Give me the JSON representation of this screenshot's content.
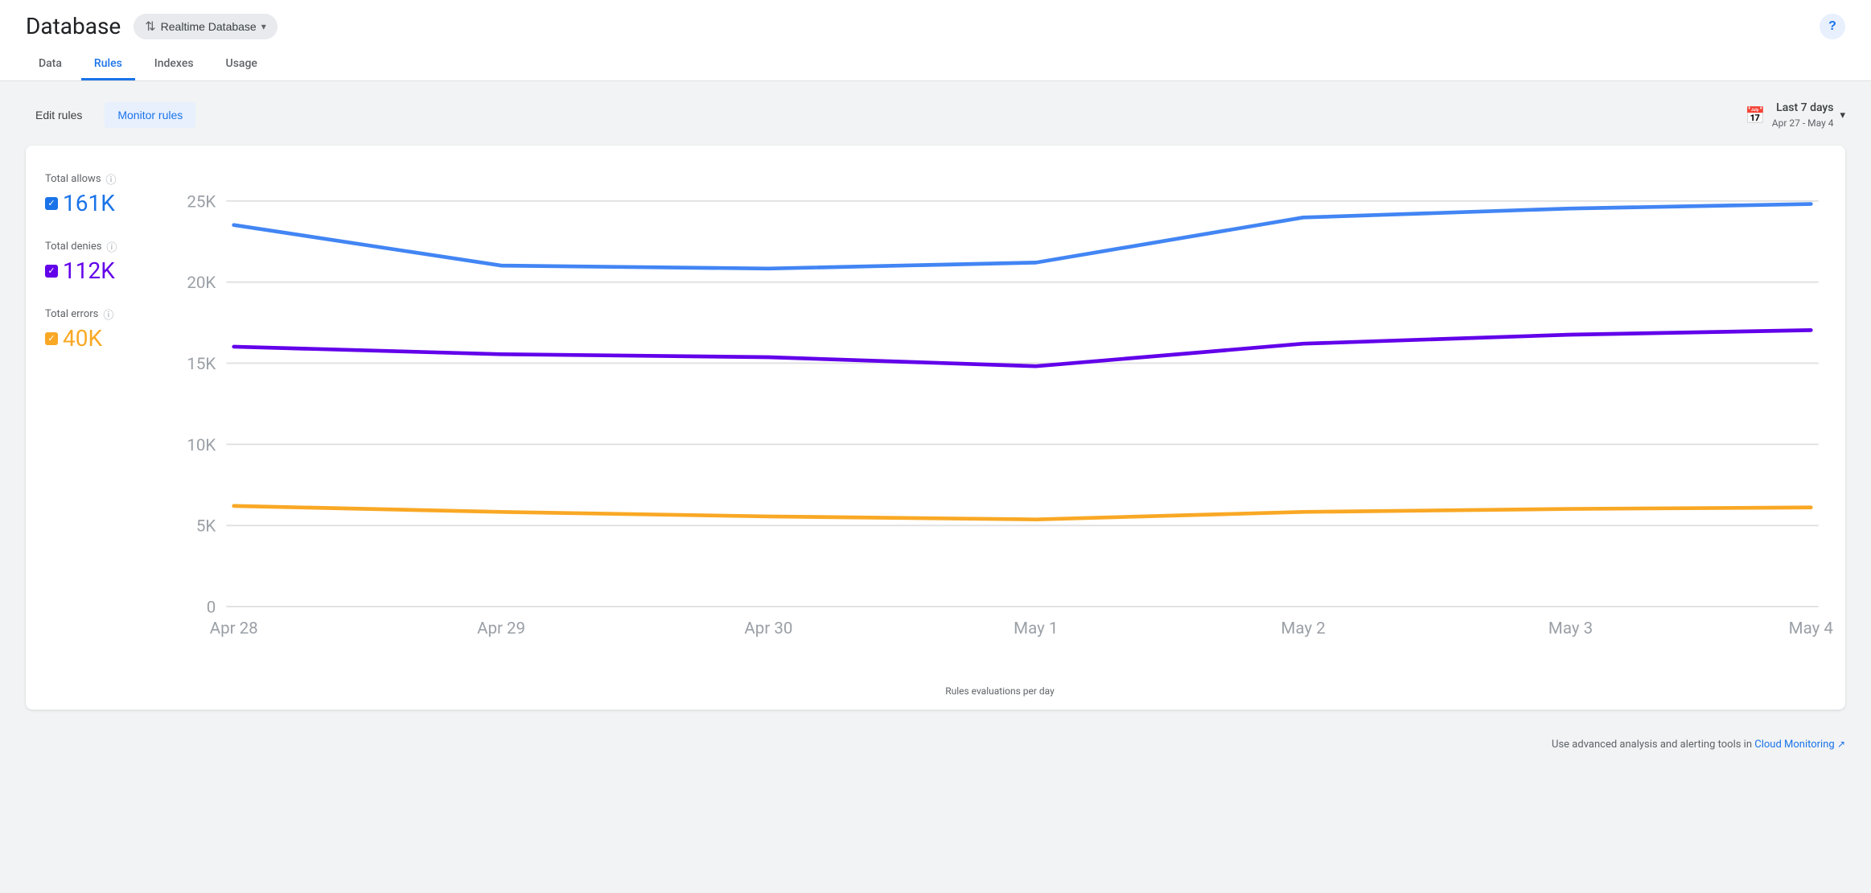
{
  "header": {
    "title": "Database",
    "db_selector": {
      "label": "Realtime Database",
      "icon": "⇅"
    },
    "help_label": "?"
  },
  "tabs": [
    {
      "id": "data",
      "label": "Data",
      "active": false
    },
    {
      "id": "rules",
      "label": "Rules",
      "active": true
    },
    {
      "id": "indexes",
      "label": "Indexes",
      "active": false
    },
    {
      "id": "usage",
      "label": "Usage",
      "active": false
    }
  ],
  "toolbar": {
    "edit_rules_label": "Edit rules",
    "monitor_rules_label": "Monitor rules",
    "date_range_main": "Last 7 days",
    "date_range_sub": "Apr 27 - May 4"
  },
  "legend": {
    "allows": {
      "label": "Total allows",
      "value": "161K",
      "color": "blue"
    },
    "denies": {
      "label": "Total denies",
      "value": "112K",
      "color": "purple"
    },
    "errors": {
      "label": "Total errors",
      "value": "40K",
      "color": "yellow"
    }
  },
  "chart": {
    "y_labels": [
      "25K",
      "20K",
      "15K",
      "10K",
      "5K",
      "0"
    ],
    "x_labels": [
      "Apr 28",
      "Apr 29",
      "Apr 30",
      "May 1",
      "May 2",
      "May 3",
      "May 4"
    ],
    "footer": "Rules evaluations per day",
    "blue_line": [
      23500,
      21000,
      20800,
      21200,
      24000,
      24500,
      24800
    ],
    "purple_line": [
      16000,
      15600,
      15400,
      14800,
      16200,
      16800,
      17000
    ],
    "yellow_line": [
      6200,
      5800,
      5600,
      5400,
      5800,
      6000,
      6100
    ]
  },
  "footer": {
    "note": "Use advanced analysis and alerting tools in",
    "link_text": "Cloud Monitoring",
    "external_icon": "↗"
  }
}
